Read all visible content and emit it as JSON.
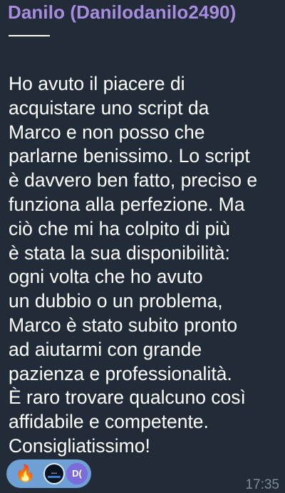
{
  "sender": {
    "name": "Danilo (Danilodanilo2490)",
    "name_color": "#a98ce0"
  },
  "message": {
    "lines": [
      "Ho avuto il piacere di",
      "acquistare uno script da",
      "Marco e non posso che",
      "parlarne benissimo. Lo script",
      "è davvero ben fatto, preciso e",
      "funziona alla perfezione. Ma",
      "ciò che mi ha colpito di più",
      "è stata la sua disponibilità:",
      "ogni volta che ho avuto",
      "un dubbio o un problema,",
      "Marco è stato subito pronto",
      "ad aiutarmi con grande",
      "pazienza e professionalità.",
      "È raro trovare qualcuno così",
      "affidabile e competente.",
      "Consigliatissimo!"
    ]
  },
  "reactions": {
    "emoji": "🔥",
    "emoji_icon": "fire-icon",
    "avatars": [
      {
        "type": "logo",
        "label": "channel logo"
      },
      {
        "type": "initials",
        "text": "D("
      }
    ],
    "pill_color": "#6ea0d6"
  },
  "meta": {
    "time": "17:35"
  },
  "theme": {
    "background": "#222c38",
    "text": "#ffffff",
    "muted": "#7e8a99"
  }
}
